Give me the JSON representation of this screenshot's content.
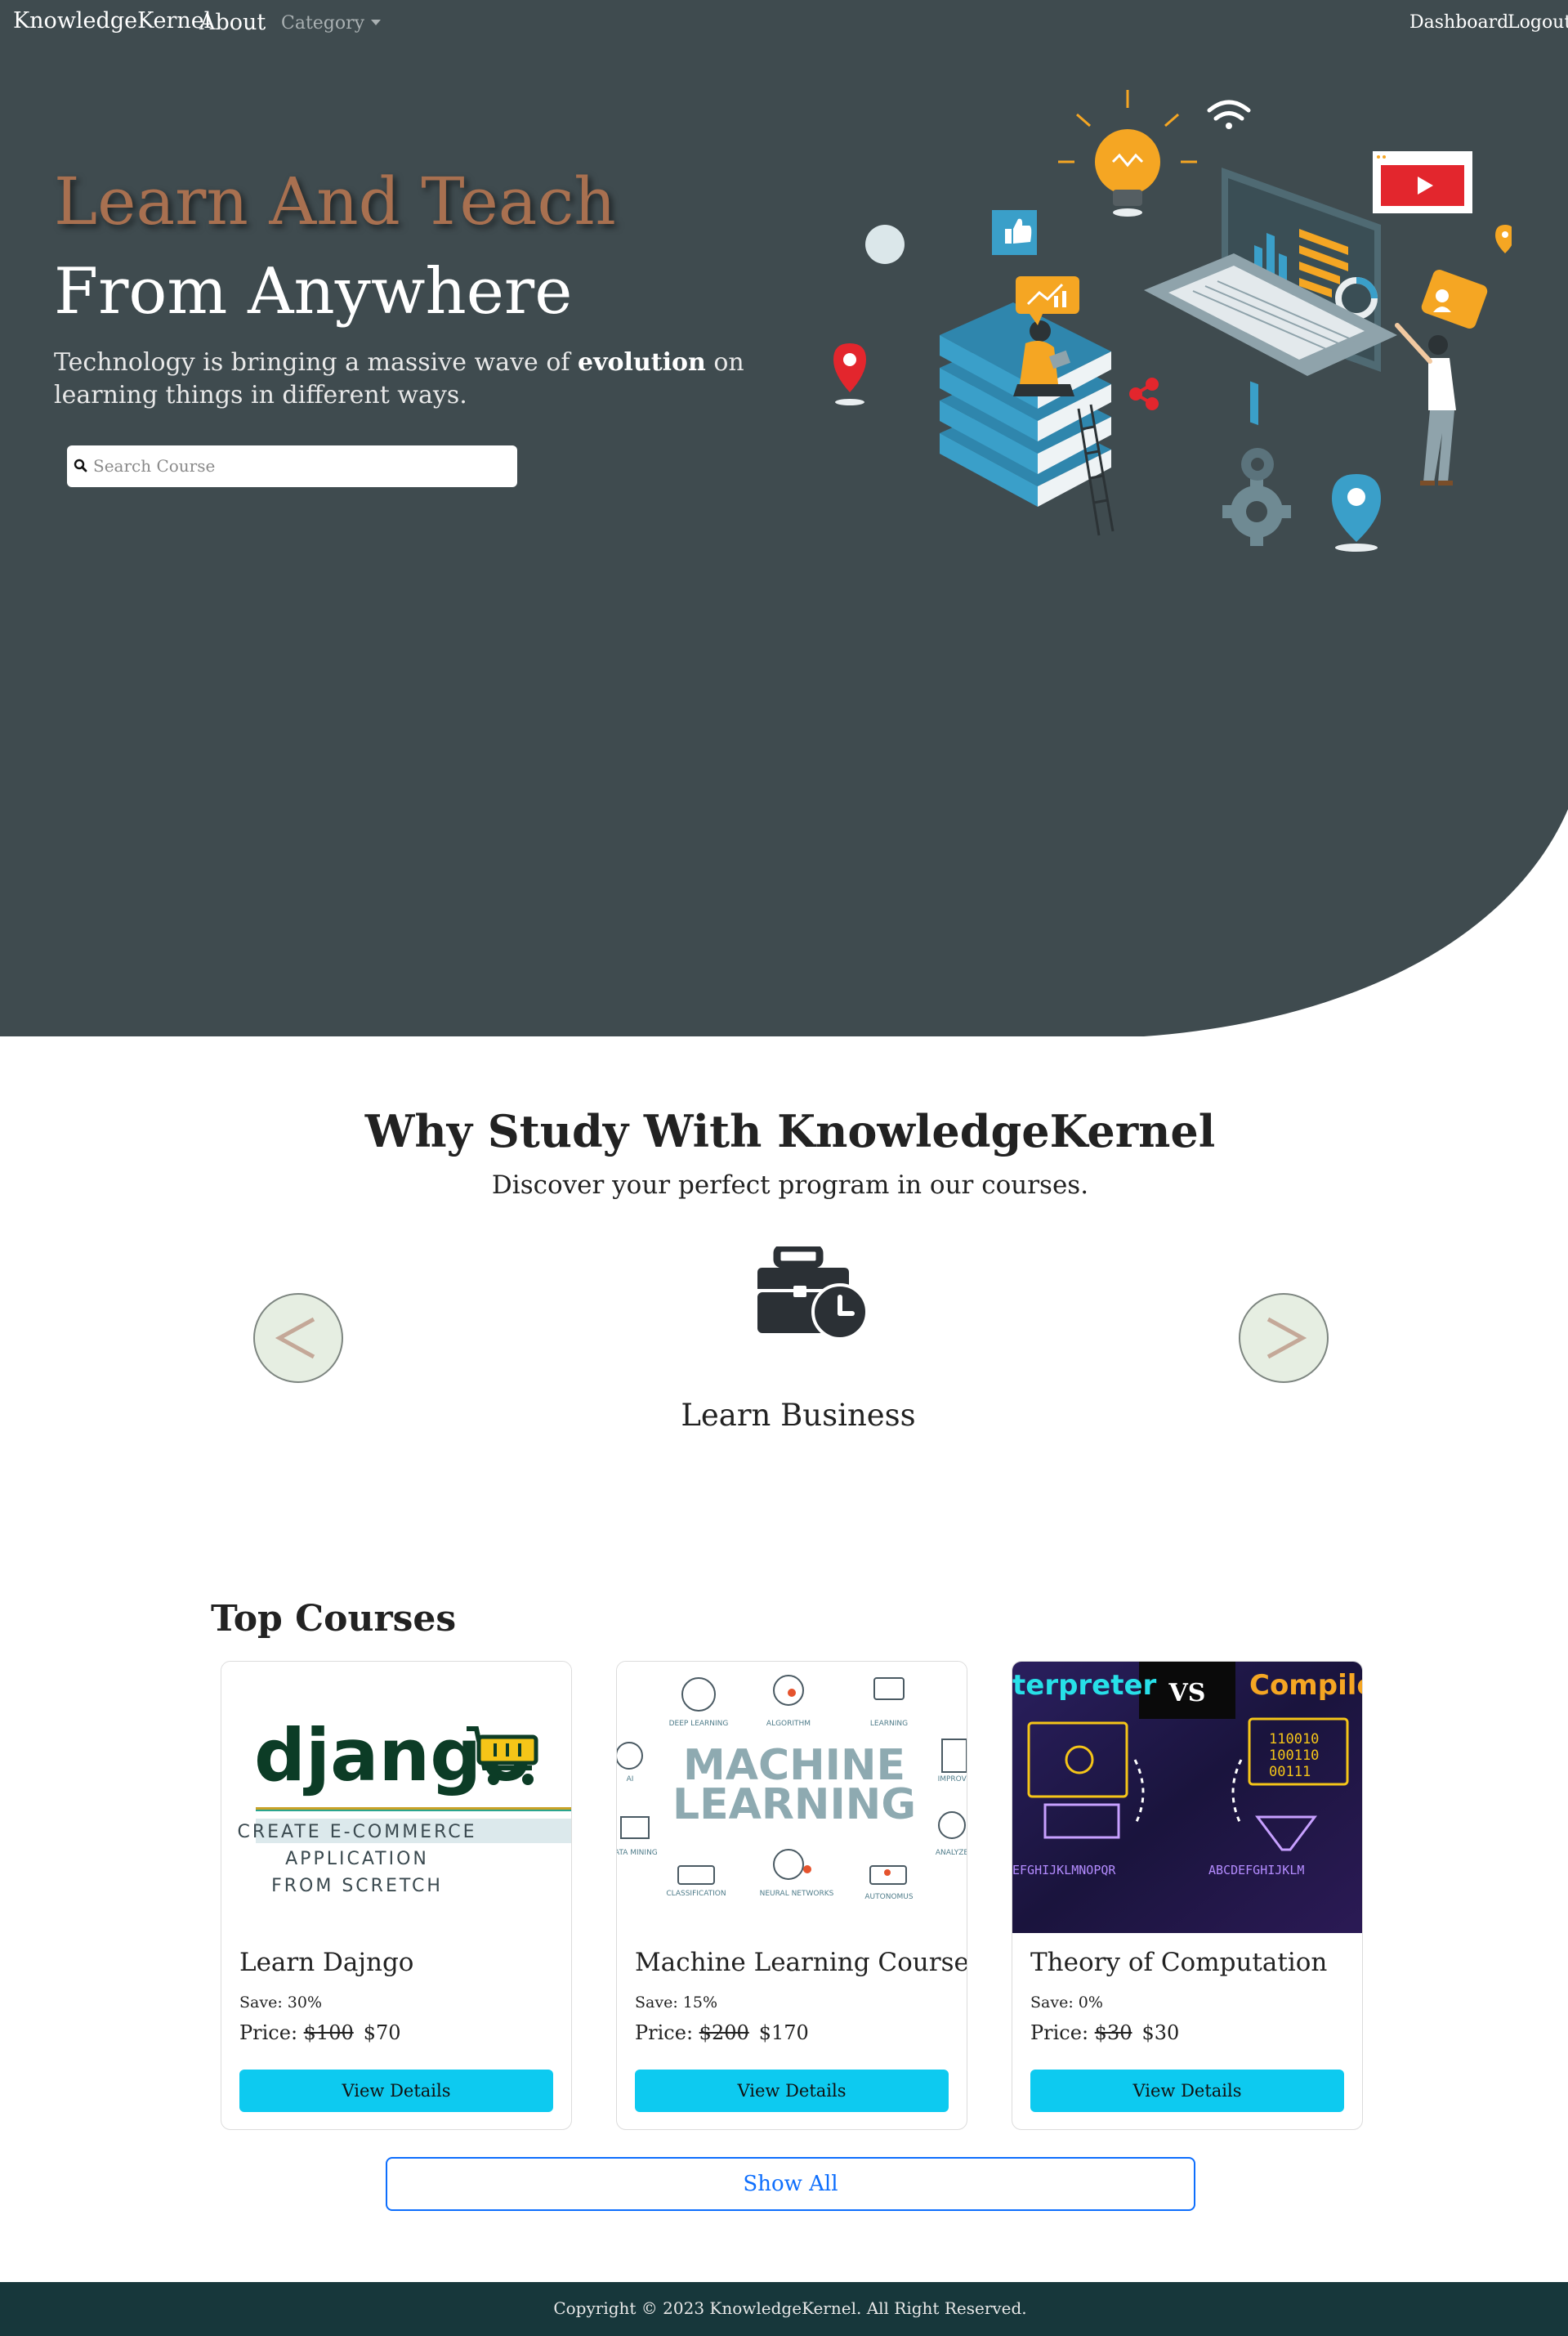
{
  "navbar": {
    "brand": "KnowledgeKernel",
    "about": "About",
    "category": "Category",
    "dashboard": "Dashboard",
    "logout": "Logout"
  },
  "hero": {
    "title_line1": "Learn And Teach",
    "title_line2": "From Anywhere",
    "subtitle_before": "Technology is bringing a massive wave of ",
    "subtitle_bold": "evolution",
    "subtitle_after": " on learning things in different ways.",
    "search_placeholder": "Search Course"
  },
  "why": {
    "title": "Why Study With KnowledgeKernel",
    "subtitle": "Discover your perfect program in our courses.",
    "prev_glyph": "<",
    "next_glyph": ">",
    "feature_label": "Learn Business",
    "feature_icon": "business-time-icon"
  },
  "top_courses": {
    "title": "Top Courses",
    "courses": [
      {
        "title": "Learn Dajngo",
        "save": "Save: 30%",
        "price_label": "Price:",
        "old_price": "$100",
        "new_price": "$70",
        "button": "View Details",
        "image_text": {
          "logo": "django",
          "line1": "CREATE E-COMMERCE",
          "line2": "APPLICATION",
          "line3": "FROM SCRETCH"
        }
      },
      {
        "title": "Machine Learning Course",
        "save": "Save: 15%",
        "price_label": "Price:",
        "old_price": "$200",
        "new_price": "$170",
        "button": "View Details",
        "image_text": {
          "line1": "MACHINE",
          "line2": "LEARNING",
          "labels": [
            "DEEP LEARNING",
            "ALGORITHM",
            "LEARNING",
            "AI",
            "IMPROVE",
            "DATA MINING",
            "ANALYZE",
            "CLASSIFICATION",
            "NEURAL NETWORKS",
            "AUTONOMUS"
          ]
        }
      },
      {
        "title": "Theory of Computation",
        "save": "Save: 0%",
        "price_label": "Price:",
        "old_price": "$30",
        "new_price": "$30",
        "button": "View Details",
        "image_text": {
          "left": "terpreter",
          "vs": "VS",
          "right": "Compile",
          "binary": [
            "110010",
            "100110",
            "00111"
          ],
          "alpha_left": "EFGHIJKLMNOPQR",
          "alpha_right": "ABCDEFGHIJKLM"
        }
      }
    ],
    "show_all": "Show All"
  },
  "footer": {
    "copyright": "Copyright © 2023 KnowledgeKernel. All Right Reserved."
  },
  "colors": {
    "hero_bg": "#3f4b4f",
    "hero_accent_title": "#a87050",
    "button_info": "#0dcaf0",
    "primary": "#0d6efd",
    "footer_bg": "#17373b",
    "arrow_bg": "#e6eee2",
    "arrow_glyph": "#c4a898"
  }
}
